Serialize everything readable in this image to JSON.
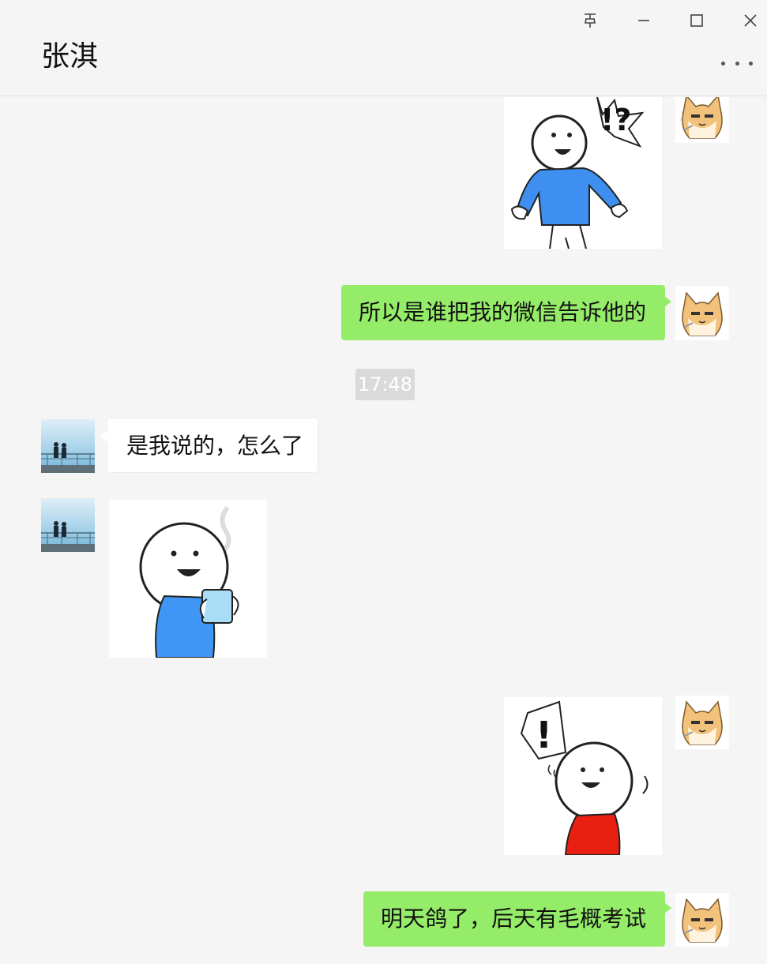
{
  "window": {
    "contact_name": "张淇",
    "controls": [
      "pin-icon",
      "minimize-icon",
      "maximize-icon",
      "close-icon"
    ]
  },
  "messages": [
    {
      "sender": "me",
      "type": "sticker",
      "sticker": "surprised-stickman-blue-shirt",
      "mark": "!?"
    },
    {
      "sender": "me",
      "type": "text",
      "text": "所以是谁把我的微信告诉他的"
    },
    {
      "type": "timestamp",
      "text": "17:48"
    },
    {
      "sender": "other",
      "type": "text",
      "text": "是我说的，怎么了"
    },
    {
      "sender": "other",
      "type": "sticker",
      "sticker": "stickman-holding-cup"
    },
    {
      "sender": "me",
      "type": "sticker",
      "sticker": "shocked-stickman-red-shirt",
      "mark": "!"
    },
    {
      "sender": "me",
      "type": "text",
      "text": "明天鸽了，后天有毛概考试"
    }
  ],
  "colors": {
    "my_bubble": "#95ec69",
    "other_bubble": "#ffffff",
    "background": "#f5f5f5",
    "timestamp_bg": "#dadada"
  }
}
